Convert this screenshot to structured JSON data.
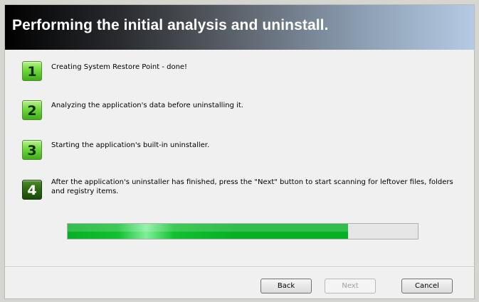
{
  "header": {
    "title": "Performing the initial analysis and uninstall."
  },
  "steps": [
    {
      "number": "1",
      "text": "Creating System Restore Point - done!",
      "status": "done"
    },
    {
      "number": "2",
      "text": "Analyzing the application's data before uninstalling it.",
      "status": "done"
    },
    {
      "number": "3",
      "text": "Starting the application's built-in uninstaller.",
      "status": "done"
    },
    {
      "number": "4",
      "text": "After the application's uninstaller has finished, press the \"Next\" button to start scanning for leftover files, folders and registry items.",
      "status": "active"
    }
  ],
  "progress": {
    "fraction": 0.8,
    "color": "#06b025"
  },
  "buttons": {
    "back_label": "Back",
    "next_label": "Next",
    "next_enabled": false,
    "cancel_label": "Cancel"
  }
}
